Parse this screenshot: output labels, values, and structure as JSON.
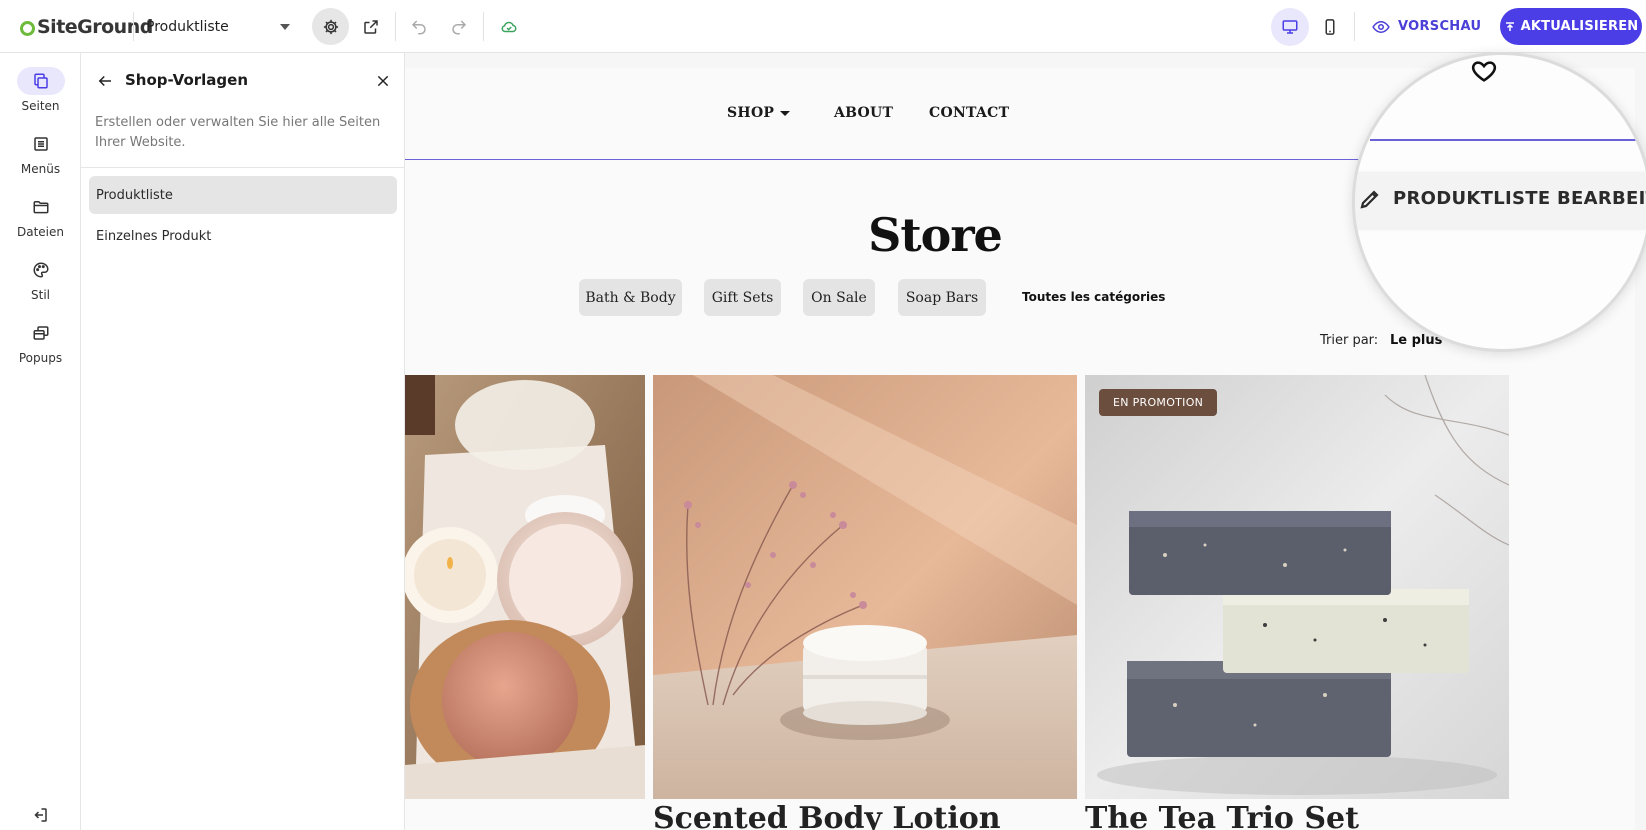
{
  "app": {
    "logo_text": "SiteGround",
    "accent_color": "#4b3ee6",
    "active_bg": "#e9e7fb"
  },
  "toolbar": {
    "page_selector": "Produktliste",
    "settings_icon": "gear-icon",
    "open_external_icon": "external-link-icon",
    "undo_icon": "undo-icon",
    "redo_icon": "redo-icon",
    "cloud_icon": "cloud-check-icon",
    "desktop_icon": "desktop-icon",
    "mobile_icon": "mobile-icon",
    "preview_label": "VORSCHAU",
    "update_label": "AKTUALISIEREN"
  },
  "rail": {
    "items": [
      {
        "label": "Seiten",
        "icon": "pages-icon",
        "active": true
      },
      {
        "label": "Menüs",
        "icon": "menu-list-icon",
        "active": false
      },
      {
        "label": "Dateien",
        "icon": "folder-icon",
        "active": false
      },
      {
        "label": "Stil",
        "icon": "palette-icon",
        "active": false
      },
      {
        "label": "Popups",
        "icon": "popup-icon",
        "active": false
      }
    ],
    "exit_icon": "exit-icon"
  },
  "panel": {
    "title": "Shop-Vorlagen",
    "description": "Erstellen oder verwalten Sie hier alle Seiten Ihrer Website.",
    "items": [
      {
        "label": "Produktliste",
        "active": true
      },
      {
        "label": "Einzelnes Produkt",
        "active": false
      }
    ]
  },
  "site": {
    "nav": [
      {
        "label": "SHOP",
        "has_dropdown": true
      },
      {
        "label": "ABOUT",
        "has_dropdown": false
      },
      {
        "label": "CONTACT",
        "has_dropdown": false
      }
    ],
    "heading": "Store",
    "categories": [
      "Bath & Body",
      "Gift Sets",
      "On Sale",
      "Soap Bars"
    ],
    "all_categories": "Toutes les catégories",
    "sort_label": "Trier par:",
    "sort_value": "Le plus",
    "products": [
      {
        "title": "",
        "badge": ""
      },
      {
        "title": "Scented Body Lotion",
        "badge": ""
      },
      {
        "title": "The Tea Trio Set",
        "badge": "EN PROMOTION"
      }
    ]
  },
  "magnifier": {
    "edit_label": "PRODUKTLISTE BEARBEITEN"
  }
}
